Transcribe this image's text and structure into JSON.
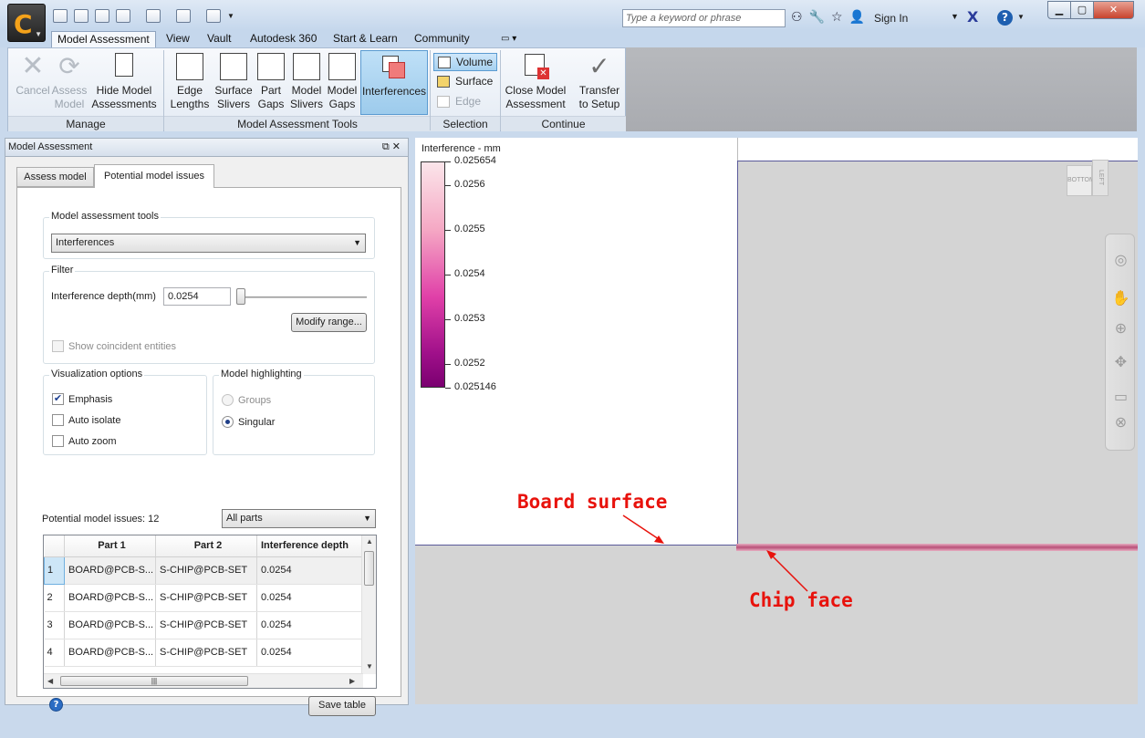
{
  "title_bar": {
    "search_placeholder": "Type a keyword or phrase",
    "sign_in": "Sign In",
    "help": "?"
  },
  "ribbon_tabs": [
    "Model Assessment",
    "View",
    "Vault",
    "Autodesk 360",
    "Start & Learn",
    "Community"
  ],
  "ribbon": {
    "manage": {
      "label": "Manage",
      "cancel": "Cancel",
      "assess_model_1": "Assess",
      "assess_model_2": "Model",
      "hide_1": "Hide Model",
      "hide_2": "Assessments"
    },
    "tools": {
      "label": "Model Assessment Tools",
      "edge_1": "Edge",
      "edge_2": "Lengths",
      "surf_1": "Surface",
      "surf_2": "Slivers",
      "partgaps_1": "Part",
      "partgaps_2": "Gaps",
      "modelsliv_1": "Model",
      "modelsliv_2": "Slivers",
      "modelgaps_1": "Model",
      "modelgaps_2": "Gaps",
      "interferences": "Interferences"
    },
    "selection": {
      "label": "Selection",
      "volume": "Volume",
      "surface": "Surface",
      "edge": "Edge"
    },
    "continue": {
      "label": "Continue",
      "close_1": "Close Model",
      "close_2": "Assessment",
      "transfer_1": "Transfer",
      "transfer_2": "to Setup"
    }
  },
  "panel": {
    "title": "Model Assessment",
    "tabs": [
      "Assess model",
      "Potential model issues"
    ],
    "tools_group": "Model assessment tools",
    "tools_value": "Interferences",
    "filter_group": "Filter",
    "depth_label": "Interference depth(mm)",
    "depth_value": "0.0254",
    "modify_range": "Modify range...",
    "show_coincident": "Show coincident entities",
    "vis_group": "Visualization options",
    "emphasis": "Emphasis",
    "auto_isolate": "Auto isolate",
    "auto_zoom": "Auto zoom",
    "emphasis_checked": true,
    "highlight_group": "Model highlighting",
    "groups": "Groups",
    "singular": "Singular",
    "issues_label": "Potential model issues: 12",
    "parts_filter": "All parts",
    "columns": [
      "Part 1",
      "Part 2",
      "Interference depth"
    ],
    "rows": [
      [
        "1",
        "BOARD@PCB-S...",
        "S-CHIP@PCB-SET",
        "0.0254"
      ],
      [
        "2",
        "BOARD@PCB-S...",
        "S-CHIP@PCB-SET",
        "0.0254"
      ],
      [
        "3",
        "BOARD@PCB-S...",
        "S-CHIP@PCB-SET",
        "0.0254"
      ],
      [
        "4",
        "BOARD@PCB-S...",
        "S-CHIP@PCB-SET",
        "0.0254"
      ]
    ],
    "save_table": "Save table"
  },
  "viewport": {
    "legend_title": "Interference - mm",
    "legend_values": [
      "0.025654",
      "0.0256",
      "0.0255",
      "0.0254",
      "0.0253",
      "0.0252",
      "0.025146"
    ],
    "annotation_board": "Board surface",
    "annotation_chip": "Chip face",
    "viewcube_faces": [
      "BOTTOM",
      "LEFT"
    ]
  },
  "colors": {
    "annotation": "#e8120c",
    "selected_ribbon": "#9dcbec",
    "legend_high": "#7a0070",
    "legend_low": "#fbe5ea"
  }
}
